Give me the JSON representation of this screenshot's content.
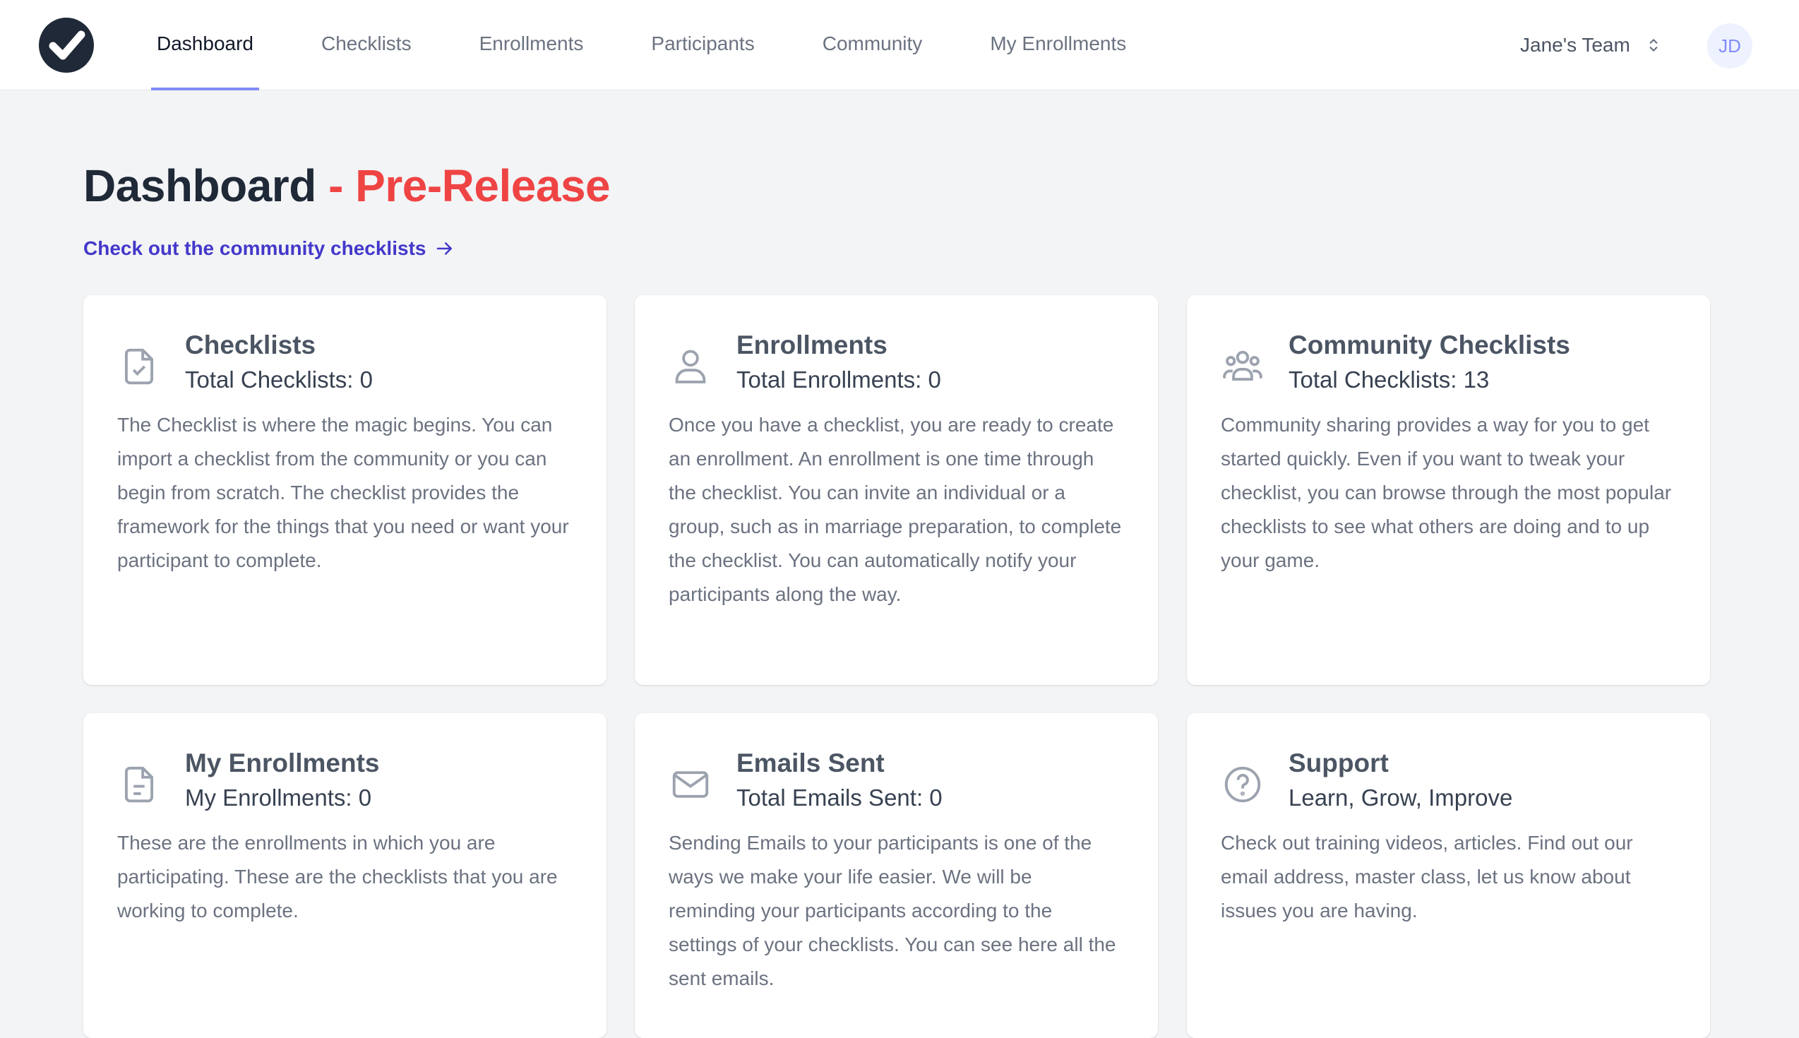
{
  "nav": {
    "tabs": [
      {
        "label": "Dashboard",
        "active": true
      },
      {
        "label": "Checklists",
        "active": false
      },
      {
        "label": "Enrollments",
        "active": false
      },
      {
        "label": "Participants",
        "active": false
      },
      {
        "label": "Community",
        "active": false
      },
      {
        "label": "My Enrollments",
        "active": false
      }
    ],
    "team_name": "Jane's Team",
    "avatar_initials": "JD"
  },
  "header": {
    "title": "Dashboard",
    "separator": "-",
    "release_tag": "Pre-Release",
    "community_link": "Check out the community checklists"
  },
  "cards": [
    {
      "icon": "document-check-icon",
      "title": "Checklists",
      "subtitle": "Total Checklists: 0",
      "body": "The Checklist is where the magic begins. You can import a checklist from the community or you can begin from scratch. The checklist provides the framework for the things that you need or want your participant to complete."
    },
    {
      "icon": "user-icon",
      "title": "Enrollments",
      "subtitle": "Total Enrollments: 0",
      "body": "Once you have a checklist, you are ready to create an enrollment. An enrollment is one time through the checklist. You can invite an individual or a group, such as in marriage preparation, to complete the checklist. You can automatically notify your participants along the way."
    },
    {
      "icon": "user-group-icon",
      "title": "Community Checklists",
      "subtitle": "Total Checklists: 13",
      "body": "Community sharing provides a way for you to get started quickly. Even if you want to tweak your checklist, you can browse through the most popular checklists to see what others are doing and to up your game."
    },
    {
      "icon": "document-text-icon",
      "title": "My Enrollments",
      "subtitle": "My Enrollments: 0",
      "body": "These are the enrollments in which you are participating. These are the checklists that you are working to complete."
    },
    {
      "icon": "mail-icon",
      "title": "Emails Sent",
      "subtitle": "Total Emails Sent: 0",
      "body": "Sending Emails to your participants is one of the ways we make your life easier. We will be reminding your participants according to the settings of your checklists. You can see here all the sent emails."
    },
    {
      "icon": "question-circle-icon",
      "title": "Support",
      "subtitle": "Learn, Grow, Improve",
      "body": "Check out training videos, articles. Find out our email address, master class, let us know about issues you are having."
    }
  ],
  "colors": {
    "accent": "#818cf8",
    "release": "#ef4444",
    "link": "#4338ca",
    "background": "#f3f4f6"
  }
}
